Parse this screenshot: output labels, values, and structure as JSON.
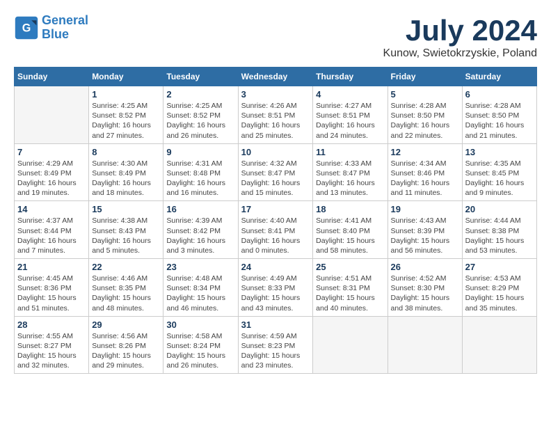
{
  "header": {
    "logo_line1": "General",
    "logo_line2": "Blue",
    "month": "July 2024",
    "location": "Kunow, Swietokrzyskie, Poland"
  },
  "columns": [
    "Sunday",
    "Monday",
    "Tuesday",
    "Wednesday",
    "Thursday",
    "Friday",
    "Saturday"
  ],
  "weeks": [
    [
      {
        "day": "",
        "empty": true
      },
      {
        "day": "1",
        "sunrise": "Sunrise: 4:25 AM",
        "sunset": "Sunset: 8:52 PM",
        "daylight": "Daylight: 16 hours and 27 minutes."
      },
      {
        "day": "2",
        "sunrise": "Sunrise: 4:25 AM",
        "sunset": "Sunset: 8:52 PM",
        "daylight": "Daylight: 16 hours and 26 minutes."
      },
      {
        "day": "3",
        "sunrise": "Sunrise: 4:26 AM",
        "sunset": "Sunset: 8:51 PM",
        "daylight": "Daylight: 16 hours and 25 minutes."
      },
      {
        "day": "4",
        "sunrise": "Sunrise: 4:27 AM",
        "sunset": "Sunset: 8:51 PM",
        "daylight": "Daylight: 16 hours and 24 minutes."
      },
      {
        "day": "5",
        "sunrise": "Sunrise: 4:28 AM",
        "sunset": "Sunset: 8:50 PM",
        "daylight": "Daylight: 16 hours and 22 minutes."
      },
      {
        "day": "6",
        "sunrise": "Sunrise: 4:28 AM",
        "sunset": "Sunset: 8:50 PM",
        "daylight": "Daylight: 16 hours and 21 minutes."
      }
    ],
    [
      {
        "day": "7",
        "sunrise": "Sunrise: 4:29 AM",
        "sunset": "Sunset: 8:49 PM",
        "daylight": "Daylight: 16 hours and 19 minutes."
      },
      {
        "day": "8",
        "sunrise": "Sunrise: 4:30 AM",
        "sunset": "Sunset: 8:49 PM",
        "daylight": "Daylight: 16 hours and 18 minutes."
      },
      {
        "day": "9",
        "sunrise": "Sunrise: 4:31 AM",
        "sunset": "Sunset: 8:48 PM",
        "daylight": "Daylight: 16 hours and 16 minutes."
      },
      {
        "day": "10",
        "sunrise": "Sunrise: 4:32 AM",
        "sunset": "Sunset: 8:47 PM",
        "daylight": "Daylight: 16 hours and 15 minutes."
      },
      {
        "day": "11",
        "sunrise": "Sunrise: 4:33 AM",
        "sunset": "Sunset: 8:47 PM",
        "daylight": "Daylight: 16 hours and 13 minutes."
      },
      {
        "day": "12",
        "sunrise": "Sunrise: 4:34 AM",
        "sunset": "Sunset: 8:46 PM",
        "daylight": "Daylight: 16 hours and 11 minutes."
      },
      {
        "day": "13",
        "sunrise": "Sunrise: 4:35 AM",
        "sunset": "Sunset: 8:45 PM",
        "daylight": "Daylight: 16 hours and 9 minutes."
      }
    ],
    [
      {
        "day": "14",
        "sunrise": "Sunrise: 4:37 AM",
        "sunset": "Sunset: 8:44 PM",
        "daylight": "Daylight: 16 hours and 7 minutes."
      },
      {
        "day": "15",
        "sunrise": "Sunrise: 4:38 AM",
        "sunset": "Sunset: 8:43 PM",
        "daylight": "Daylight: 16 hours and 5 minutes."
      },
      {
        "day": "16",
        "sunrise": "Sunrise: 4:39 AM",
        "sunset": "Sunset: 8:42 PM",
        "daylight": "Daylight: 16 hours and 3 minutes."
      },
      {
        "day": "17",
        "sunrise": "Sunrise: 4:40 AM",
        "sunset": "Sunset: 8:41 PM",
        "daylight": "Daylight: 16 hours and 0 minutes."
      },
      {
        "day": "18",
        "sunrise": "Sunrise: 4:41 AM",
        "sunset": "Sunset: 8:40 PM",
        "daylight": "Daylight: 15 hours and 58 minutes."
      },
      {
        "day": "19",
        "sunrise": "Sunrise: 4:43 AM",
        "sunset": "Sunset: 8:39 PM",
        "daylight": "Daylight: 15 hours and 56 minutes."
      },
      {
        "day": "20",
        "sunrise": "Sunrise: 4:44 AM",
        "sunset": "Sunset: 8:38 PM",
        "daylight": "Daylight: 15 hours and 53 minutes."
      }
    ],
    [
      {
        "day": "21",
        "sunrise": "Sunrise: 4:45 AM",
        "sunset": "Sunset: 8:36 PM",
        "daylight": "Daylight: 15 hours and 51 minutes."
      },
      {
        "day": "22",
        "sunrise": "Sunrise: 4:46 AM",
        "sunset": "Sunset: 8:35 PM",
        "daylight": "Daylight: 15 hours and 48 minutes."
      },
      {
        "day": "23",
        "sunrise": "Sunrise: 4:48 AM",
        "sunset": "Sunset: 8:34 PM",
        "daylight": "Daylight: 15 hours and 46 minutes."
      },
      {
        "day": "24",
        "sunrise": "Sunrise: 4:49 AM",
        "sunset": "Sunset: 8:33 PM",
        "daylight": "Daylight: 15 hours and 43 minutes."
      },
      {
        "day": "25",
        "sunrise": "Sunrise: 4:51 AM",
        "sunset": "Sunset: 8:31 PM",
        "daylight": "Daylight: 15 hours and 40 minutes."
      },
      {
        "day": "26",
        "sunrise": "Sunrise: 4:52 AM",
        "sunset": "Sunset: 8:30 PM",
        "daylight": "Daylight: 15 hours and 38 minutes."
      },
      {
        "day": "27",
        "sunrise": "Sunrise: 4:53 AM",
        "sunset": "Sunset: 8:29 PM",
        "daylight": "Daylight: 15 hours and 35 minutes."
      }
    ],
    [
      {
        "day": "28",
        "sunrise": "Sunrise: 4:55 AM",
        "sunset": "Sunset: 8:27 PM",
        "daylight": "Daylight: 15 hours and 32 minutes."
      },
      {
        "day": "29",
        "sunrise": "Sunrise: 4:56 AM",
        "sunset": "Sunset: 8:26 PM",
        "daylight": "Daylight: 15 hours and 29 minutes."
      },
      {
        "day": "30",
        "sunrise": "Sunrise: 4:58 AM",
        "sunset": "Sunset: 8:24 PM",
        "daylight": "Daylight: 15 hours and 26 minutes."
      },
      {
        "day": "31",
        "sunrise": "Sunrise: 4:59 AM",
        "sunset": "Sunset: 8:23 PM",
        "daylight": "Daylight: 15 hours and 23 minutes."
      },
      {
        "day": "",
        "empty": true
      },
      {
        "day": "",
        "empty": true
      },
      {
        "day": "",
        "empty": true
      }
    ]
  ]
}
